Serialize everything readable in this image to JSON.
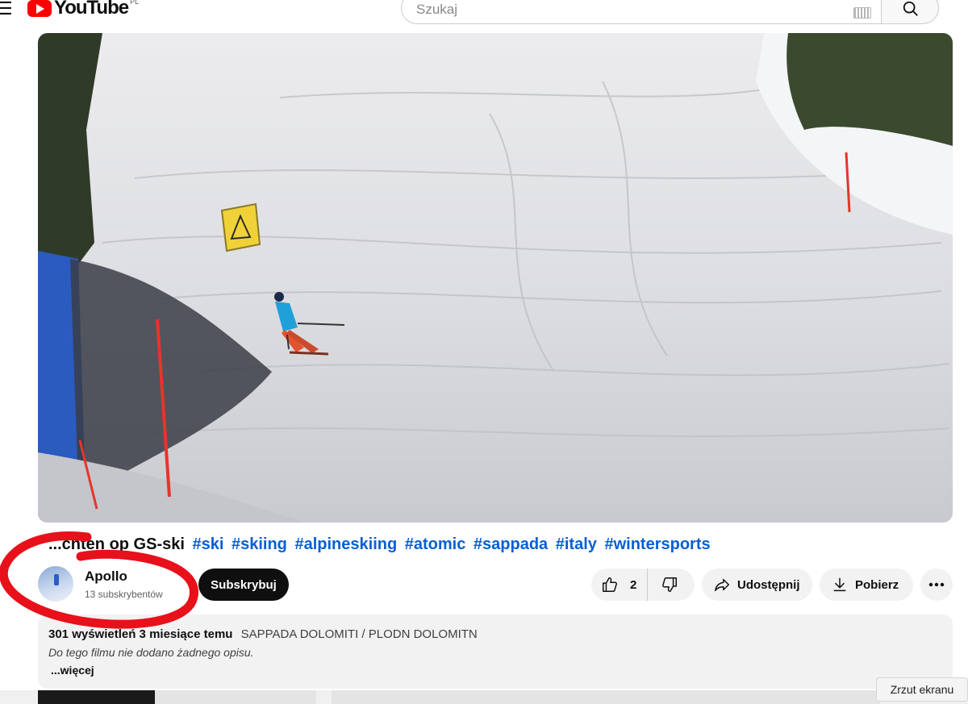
{
  "header": {
    "logo_text": "YouTube",
    "region_code": "PL",
    "search_placeholder": "Szukaj"
  },
  "video": {
    "title_text": "...chten op GS-ski",
    "hashtags": [
      "#ski",
      "#skiing",
      "#alpineskiing",
      "#atomic",
      "#sappada",
      "#italy",
      "#wintersports"
    ]
  },
  "channel": {
    "name": "Apollo",
    "subscribers": "13 subskrybentów",
    "subscribe_label": "Subskrybuj"
  },
  "actions": {
    "like_count": "2",
    "share_label": "Udostępnij",
    "download_label": "Pobierz"
  },
  "description": {
    "meta": "301 wyświetleń  3 miesiące temu",
    "location": "SAPPADA DOLOMITI / PLODN DOLOMITN",
    "body": "Do tego filmu nie dodano żadnego opisu.",
    "more_label": "...więcej"
  },
  "tooltip": {
    "text": "Zrzut ekranu"
  },
  "colors": {
    "brand_red": "#ff0000",
    "hashtag_blue": "#065fd4",
    "annotation_red": "#e8101a"
  }
}
